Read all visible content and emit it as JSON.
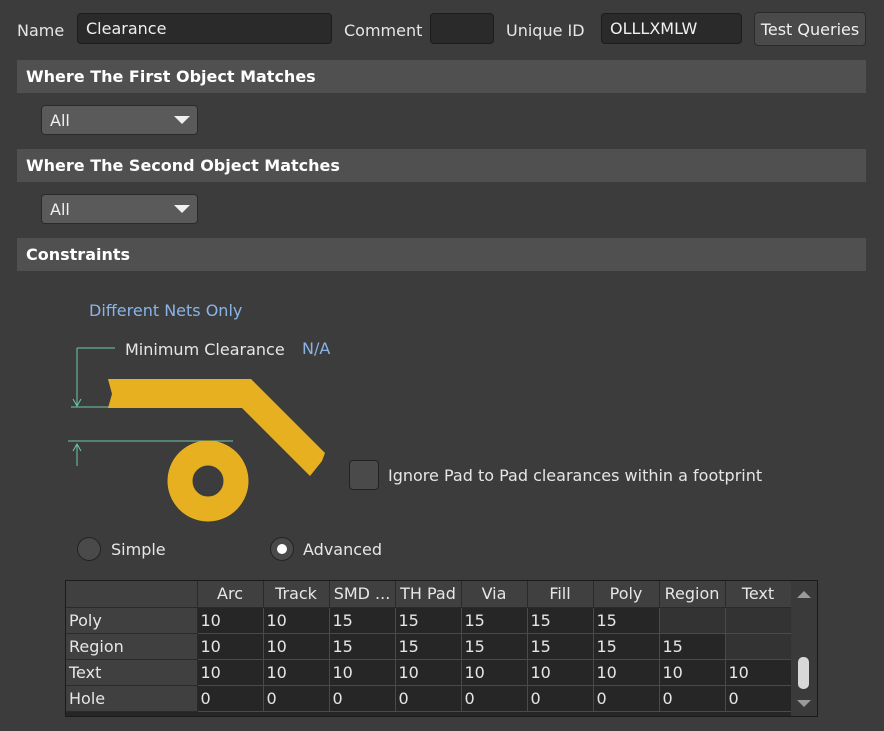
{
  "header": {
    "name_label": "Name",
    "name_value": "Clearance",
    "comment_label": "Comment",
    "comment_value": "",
    "uid_label": "Unique ID",
    "uid_value": "OLLLXMLW",
    "test_queries_label": "Test Queries"
  },
  "first_match": {
    "title": "Where The First Object Matches",
    "selected": "All"
  },
  "second_match": {
    "title": "Where The Second Object Matches",
    "selected": "All"
  },
  "constraints": {
    "title": "Constraints",
    "net_scope": "Different Nets Only",
    "min_clearance_label": "Minimum Clearance",
    "min_clearance_value": "N/A",
    "ignore_pad_label": "Ignore Pad to Pad clearances within a footprint",
    "ignore_pad_checked": false,
    "mode_simple_label": "Simple",
    "mode_advanced_label": "Advanced",
    "mode_selected": "Advanced",
    "diagram_color": "#e6b020"
  },
  "grid": {
    "columns": [
      "Arc",
      "Track",
      "SMD ...",
      "TH Pad",
      "Via",
      "Fill",
      "Poly",
      "Region",
      "Text"
    ],
    "rows": [
      {
        "label": "Poly",
        "values": [
          "10",
          "10",
          "15",
          "15",
          "15",
          "15",
          "15",
          "",
          ""
        ]
      },
      {
        "label": "Region",
        "values": [
          "10",
          "10",
          "15",
          "15",
          "15",
          "15",
          "15",
          "15",
          ""
        ]
      },
      {
        "label": "Text",
        "values": [
          "10",
          "10",
          "10",
          "10",
          "10",
          "10",
          "10",
          "10",
          "10"
        ]
      },
      {
        "label": "Hole",
        "values": [
          "0",
          "0",
          "0",
          "0",
          "0",
          "0",
          "0",
          "0",
          "0"
        ]
      }
    ]
  }
}
